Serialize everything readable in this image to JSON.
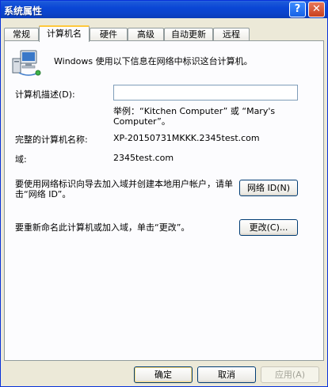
{
  "window": {
    "title": "系统属性"
  },
  "titlebar_buttons": {
    "help": "?",
    "close": "✕"
  },
  "tabs": [
    {
      "label": "常规"
    },
    {
      "label": "计算机名"
    },
    {
      "label": "硬件"
    },
    {
      "label": "高级"
    },
    {
      "label": "自动更新"
    },
    {
      "label": "远程"
    }
  ],
  "computer_name_tab": {
    "intro": "Windows 使用以下信息在网络中标识这台计算机。",
    "description_label": "计算机描述(D):",
    "description_value": "",
    "example": "举例：“Kitchen Computer” 或 “Mary's Computer”。",
    "full_name_label": "完整的计算机名称:",
    "full_name_value": "XP-20150731MKKK.2345test.com",
    "domain_label": "域:",
    "domain_value": "2345test.com",
    "network_id_text": "要使用网络标识向导去加入域并创建本地用户帐户，请单击“网络 ID”。",
    "network_id_button": "网络 ID(N)",
    "rename_text": "要重新命名此计算机或加入域，单击“更改”。",
    "change_button": "更改(C)..."
  },
  "footer": {
    "ok": "确定",
    "cancel": "取消",
    "apply": "应用(A)"
  },
  "icons": {
    "computer": "computer-network-icon"
  }
}
